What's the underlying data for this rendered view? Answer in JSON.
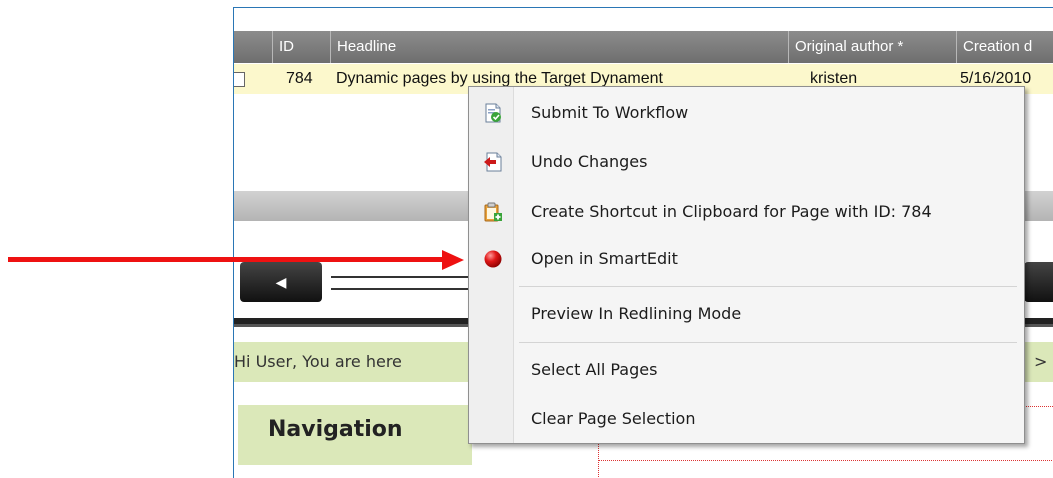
{
  "grid": {
    "columns": {
      "id": "ID",
      "headline": "Headline",
      "author": "Original author *",
      "created": "Creation d"
    },
    "rows": [
      {
        "id": "784",
        "headline": "Dynamic pages by using the Target Dynament",
        "author": "kristen",
        "created": "5/16/2010"
      }
    ]
  },
  "scroll": {
    "left_glyph": "◀"
  },
  "greeting": {
    "text": "Hi User, You are here",
    "arrow": ">"
  },
  "navigation": {
    "title": "Navigation"
  },
  "context_menu": {
    "items": [
      {
        "label": "Submit To Workflow",
        "icon": "submit-workflow-icon"
      },
      {
        "label": "Undo Changes",
        "icon": "undo-changes-icon"
      },
      {
        "label": "Create Shortcut in Clipboard for Page with ID: 784",
        "icon": "clipboard-shortcut-icon"
      },
      {
        "label": "Open in SmartEdit",
        "icon": "smartedit-red-dot-icon"
      },
      {
        "label": "Preview In Redlining Mode",
        "icon": ""
      },
      {
        "label": "Select All Pages",
        "icon": ""
      },
      {
        "label": "Clear Page Selection",
        "icon": ""
      }
    ]
  },
  "colors": {
    "accent_arrow": "#ee1111",
    "row_highlight": "#fcf8cc",
    "breadcrumb_bg": "#dbe8b9",
    "header_gray": "#7a7a7a"
  }
}
